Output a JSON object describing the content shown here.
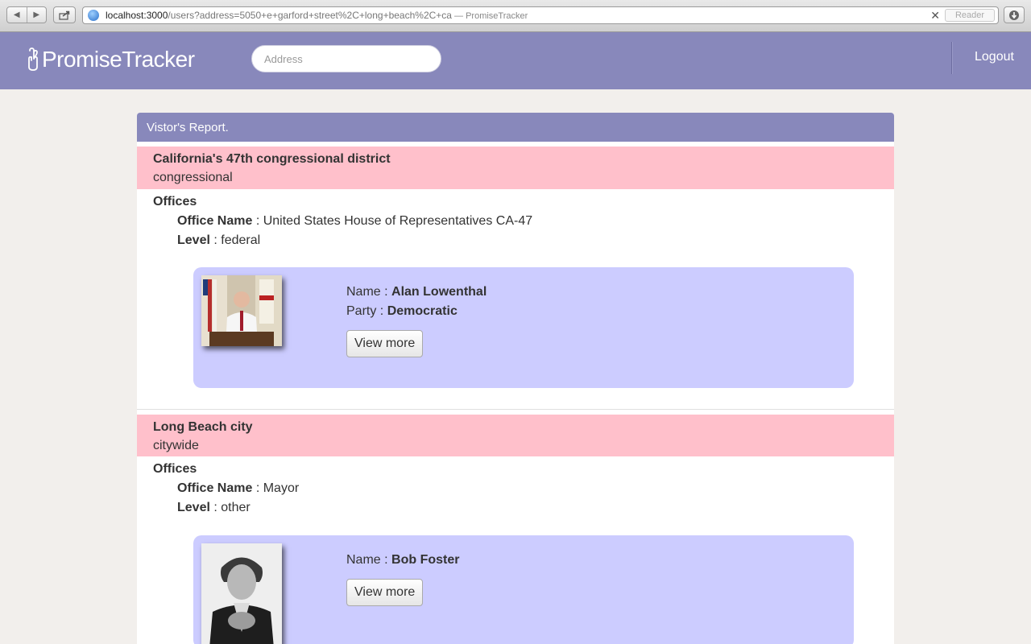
{
  "browser": {
    "url_host": "localhost:3000",
    "url_path": "/users?address=5050+e+garford+street%2C+long+beach%2C+ca",
    "page_title": " — PromiseTracker",
    "reader_label": "Reader"
  },
  "header": {
    "logo_text": "PromiseTracker",
    "search_placeholder": "Address",
    "logout_label": "Logout"
  },
  "report": {
    "title": "Vistor's Report.",
    "districts": [
      {
        "name": "California's 47th congressional district",
        "type": "congressional",
        "offices_label": "Offices",
        "office_name_label": "Office Name",
        "office_name": "United States House of Representatives CA-47",
        "level_label": "Level",
        "level": "federal",
        "official": {
          "name_label": "Name",
          "name": "Alan Lowenthal",
          "party_label": "Party",
          "party": "Democratic",
          "button_label": "View more"
        }
      },
      {
        "name": "Long Beach city",
        "type": "citywide",
        "offices_label": "Offices",
        "office_name_label": "Office Name",
        "office_name": "Mayor",
        "level_label": "Level",
        "level": "other",
        "official": {
          "name_label": "Name",
          "name": "Bob Foster",
          "button_label": "View more"
        }
      }
    ]
  },
  "colors": {
    "header_bg": "#8888bb",
    "district_band": "#ffc0cb",
    "card_bg": "#ccccff"
  }
}
